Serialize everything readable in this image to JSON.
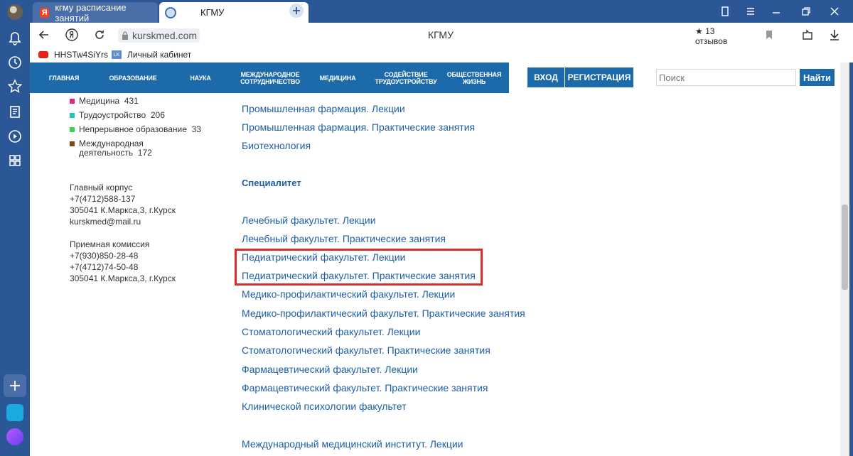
{
  "browser": {
    "tabs": [
      {
        "label": "кгму расписание занятий"
      },
      {
        "label": "КГМУ"
      }
    ],
    "url": "kurskmed.com",
    "title": "КГМУ",
    "reviews": "13 отзывов",
    "bookmarks": [
      {
        "label": "HHSTw4SiYrs"
      },
      {
        "label": "Личный кабинет"
      }
    ]
  },
  "site": {
    "nav": [
      {
        "label": "ГЛАВНАЯ"
      },
      {
        "label": "ОБРАЗОВАНИЕ"
      },
      {
        "label": "НАУКА"
      },
      {
        "label": "МЕЖДУНАРОДНОЕ СОТРУДНИЧЕСТВО"
      },
      {
        "label": "МЕДИЦИНА"
      },
      {
        "label": "СОДЕЙСТВИЕ ТРУДОУСТРОЙСТВУ"
      },
      {
        "label": "ОБЩЕСТВЕННАЯ ЖИЗНЬ"
      }
    ],
    "login": "ВХОД",
    "register": "РЕГИСТРАЦИЯ",
    "search_placeholder": "Поиск",
    "search_button": "Найти"
  },
  "stats": [
    {
      "label": "Медицина",
      "count": "431",
      "color": "#e0287f"
    },
    {
      "label": "Трудоустройство",
      "count": "206",
      "color": "#1fc7b4"
    },
    {
      "label": "Непрерывное образование",
      "count": "33",
      "color": "#39d353"
    },
    {
      "label": "Международная деятельность",
      "count": "172",
      "color": "#7a4a1c"
    }
  ],
  "contacts": {
    "main": [
      "Главный корпус",
      "+7(4712)588-137",
      "305041 К.Маркса,3, г.Курск",
      "kurskmed@mail.ru"
    ],
    "admission": [
      "Приемная комиссия",
      "+7(930)850-28-48",
      "+7(4712)74-50-48",
      "305041 К.Маркса,3, г.Курск"
    ]
  },
  "links": {
    "top": [
      "Промышленная фармация. Лекции",
      "Промышленная фармация. Практические занятия",
      "Биотехнология"
    ],
    "section_title": "Специалитет",
    "specialist": [
      "Лечебный факультет. Лекции",
      "Лечебный факультет. Практические занятия",
      "Педиатрический факультет. Лекции",
      "Педиатрический факультет. Практические занятия",
      "Медико-профилактический факультет. Лекции",
      "Медико-профилактический факультет. Практические занятия",
      "Стоматологический факультет. Лекции",
      "Стоматологический факультет. Практические занятия",
      "Фармацевтический факультет. Лекции",
      "Фармацевтический факультет. Практические занятия",
      "Клинической психологии факультет"
    ],
    "bottom": [
      "Международный медицинский институт. Лекции"
    ]
  }
}
